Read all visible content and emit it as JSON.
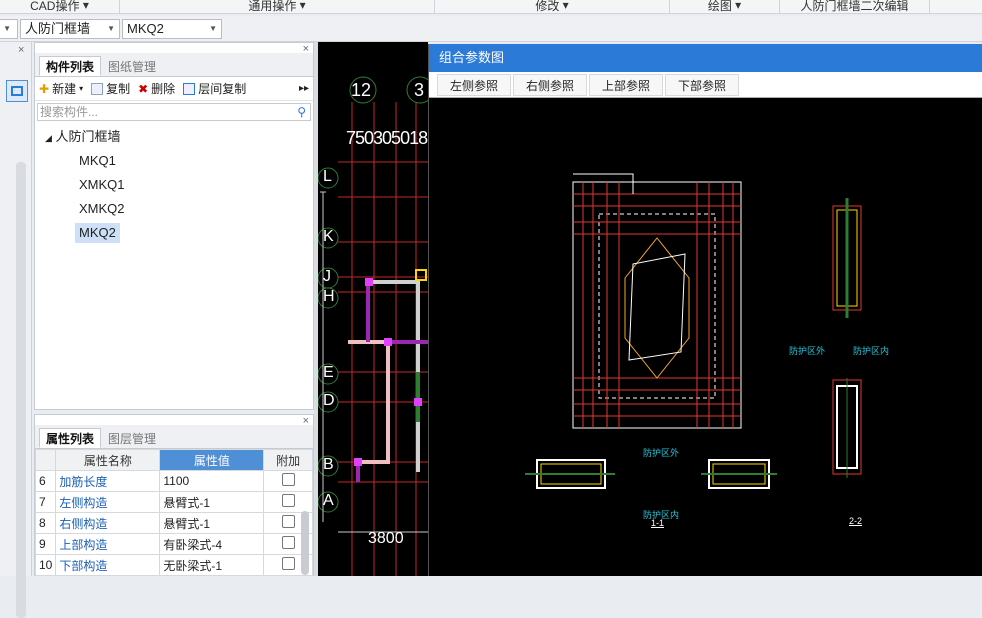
{
  "ribbon": {
    "groups": [
      "CAD操作",
      "通用操作",
      "修改",
      "绘图",
      "人防门框墙二次编辑"
    ]
  },
  "toolbar": {
    "dropdown1": "人防门框墙",
    "dropdown2": "MKQ2"
  },
  "component_panel": {
    "tabs": [
      "构件列表",
      "图纸管理"
    ],
    "actions": [
      "新建",
      "复制",
      "删除",
      "层间复制"
    ],
    "search_placeholder": "搜索构件...",
    "tree_root": "人防门框墙",
    "items": [
      "MKQ1",
      "XMKQ1",
      "XMKQ2",
      "MKQ2"
    ],
    "selected": "MKQ2"
  },
  "property_panel": {
    "tabs": [
      "属性列表",
      "图层管理"
    ],
    "headers": [
      "属性名称",
      "属性值",
      "附加"
    ],
    "rows": [
      {
        "no": "6",
        "name": "加筋长度",
        "value": "1100"
      },
      {
        "no": "7",
        "name": "左侧构造",
        "value": "悬臂式-1"
      },
      {
        "no": "8",
        "name": "右侧构造",
        "value": "悬臂式-1"
      },
      {
        "no": "9",
        "name": "上部构造",
        "value": "有卧梁式-4"
      },
      {
        "no": "10",
        "name": "下部构造",
        "value": "无卧梁式-1"
      }
    ]
  },
  "cad": {
    "axis_numbers": [
      "12",
      "3"
    ],
    "axis_letters": [
      "L",
      "K",
      "J",
      "H",
      "E",
      "D",
      "B",
      "A"
    ],
    "dims_top": "750305018",
    "dim_bottom": "3800"
  },
  "dialog": {
    "title": "组合参数图",
    "buttons": [
      "左侧参照",
      "右侧参照",
      "上部参照",
      "下部参照"
    ],
    "labels": {
      "outside1": "防护区外",
      "inside1": "防护区内",
      "section11": "1-1",
      "section22": "2-2",
      "outside_r": "防护区外",
      "inside_r": "防护区内"
    }
  },
  "colors": {
    "accent": "#2b7ad8",
    "selected_bg": "#cde0f7",
    "header_highlight": "#4f8fd6",
    "link_text": "#1a5fb4"
  }
}
